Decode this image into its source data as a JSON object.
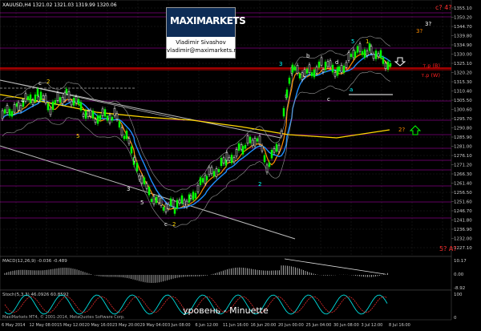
{
  "chart": {
    "symbol_header": "XAUUSD,H4  1321.02 1321.03 1319.99 1320.06",
    "colors": {
      "background": "#000000",
      "grid": "#1e1e1e",
      "candle_up": "#00ff00",
      "candle_down": "#ffffff",
      "ma_fast": "#ff8c00",
      "ma_mid": "#1e90ff",
      "ma_slow": "#ffd700",
      "level_line": "#ff00ff",
      "pivot_red": "#ff0000"
    },
    "price_ticks": [
      "1355.10",
      "1350.20",
      "1344.70",
      "1339.80",
      "1334.90",
      "1330.00",
      "1325.10",
      "1320.20",
      "1315.30",
      "1310.40",
      "1305.50",
      "1300.60",
      "1295.70",
      "1290.80",
      "1285.90",
      "1281.00",
      "1276.10",
      "1271.20",
      "1266.30",
      "1261.40",
      "1256.50",
      "1251.60",
      "1246.70",
      "1241.80",
      "1236.90",
      "1232.00",
      "1227.10"
    ],
    "level_labels": [
      "т.р (В)",
      "т.р (W)"
    ],
    "wave_labels": {
      "c4": "c? 4?",
      "top3": "3?",
      "mid3": "3?",
      "right2": "2?",
      "fiveA": "5? A?"
    }
  },
  "watermark": {
    "brand": "MAXIMARKETS",
    "name": "Vladimir Sivashov",
    "email": "vladimir@maximarkets.ru"
  },
  "macd": {
    "header": "MACD(12,26,9) -0.036 -0.489",
    "ticks": [
      "10.17",
      "0.00",
      "-8.92"
    ]
  },
  "stoch": {
    "header": "Stoch(5,3,3) 46.0926 60.8592",
    "ticks": [
      "100",
      "0"
    ],
    "caption": "уровень - Minuette"
  },
  "footer": {
    "left": "MaxiMarkets MT4, © 2001-2014, MetaQuotes Software Corp.",
    "dates": [
      "6 May 2014",
      "12 May 08:00",
      "15 May 12:00",
      "20 May 16:00",
      "23 May 20:00",
      "29 May 04:00",
      "3 Jun 08:00",
      "6 Jun 12:00",
      "11 Jun 16:00",
      "16 Jun 20:00",
      "20 Jun 00:00",
      "25 Jun 04:00",
      "30 Jun 08:00",
      "3 Jul 12:00",
      "8 Jul 16:00"
    ]
  }
}
